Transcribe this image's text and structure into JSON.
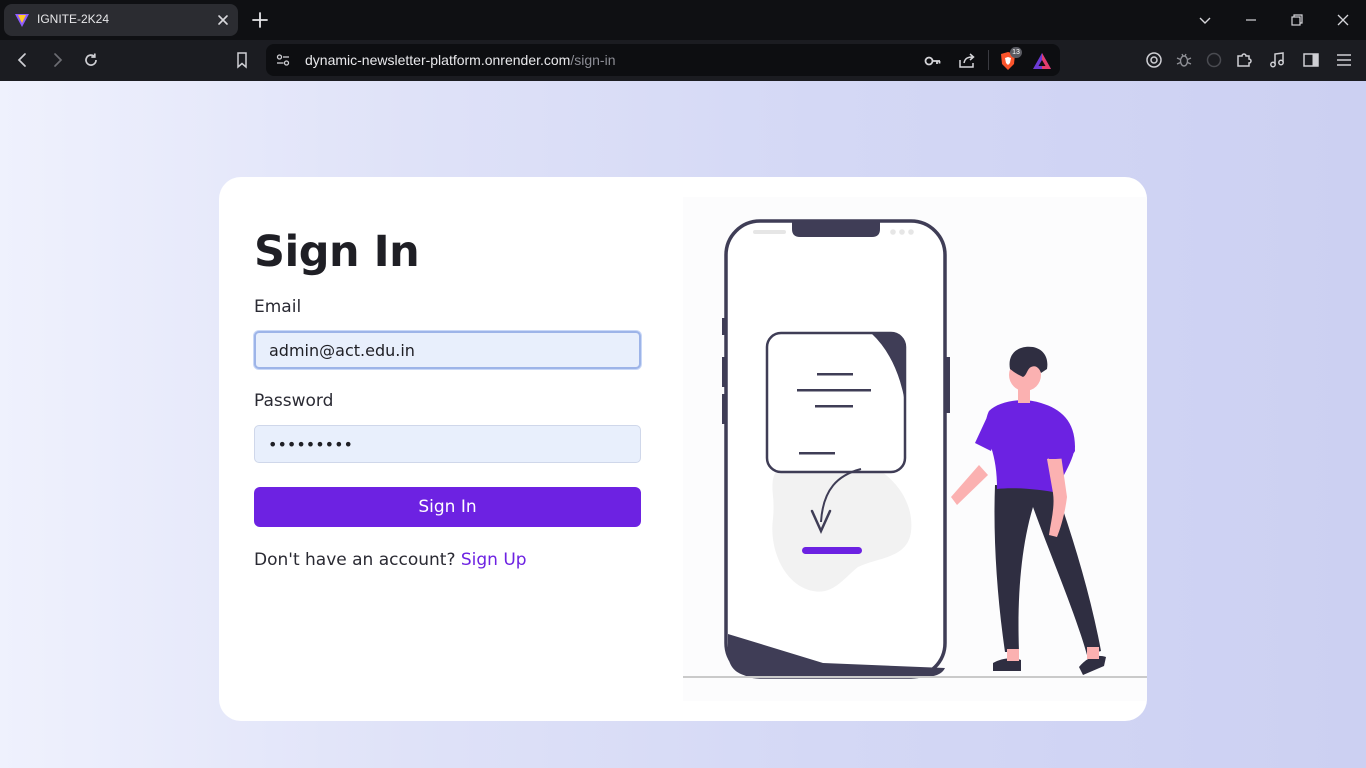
{
  "browser": {
    "tab": {
      "title": "IGNITE-2K24"
    },
    "address": {
      "domain": "dynamic-newsletter-platform.onrender.com",
      "path": "/sign-in"
    },
    "shields_count": "13"
  },
  "colors": {
    "accent": "#6d22e2",
    "input_bg": "#e8effc",
    "page_bg_start": "#eff1fd",
    "page_bg_end": "#ccd0f2",
    "text": "#1f1f25"
  },
  "form": {
    "title": "Sign In",
    "email": {
      "label": "Email",
      "value": "admin@act.edu.in"
    },
    "password": {
      "label": "Password",
      "value": "*********"
    },
    "submit_label": "Sign In",
    "signup_prompt": "Don't have an account?",
    "signup_link": "Sign Up"
  },
  "icons": [
    "back-icon",
    "forward-icon",
    "reload-icon",
    "bookmark-icon",
    "site-settings-icon",
    "key-icon",
    "share-icon",
    "brave-shields-icon",
    "brave-rewards-icon",
    "extension-icon",
    "puzzle-icon",
    "media-icon",
    "sidebar-icon",
    "menu-icon"
  ]
}
